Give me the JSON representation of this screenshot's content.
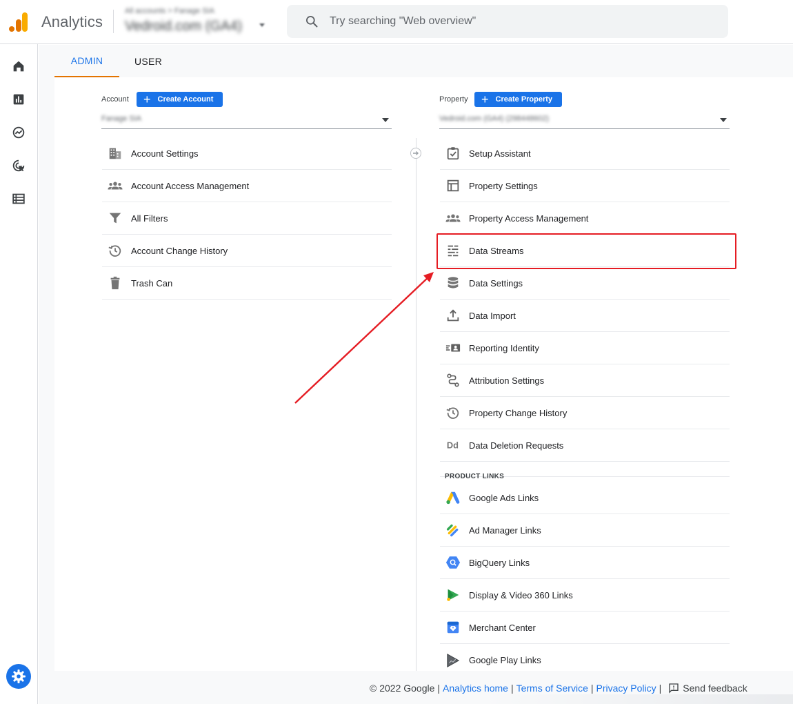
{
  "header": {
    "app_title": "Analytics",
    "account_path": "All accounts > Fanage SIA",
    "account_name": "Vedroid.com (GA4)",
    "search_placeholder": "Try searching \"Web overview\""
  },
  "rail": {
    "items": [
      {
        "name": "home",
        "icon": "home-icon"
      },
      {
        "name": "reports",
        "icon": "bar-chart-icon"
      },
      {
        "name": "explore",
        "icon": "explore-icon"
      },
      {
        "name": "advertising",
        "icon": "cursor-target-icon"
      },
      {
        "name": "configure",
        "icon": "list-icon"
      }
    ],
    "admin_icon": "gear-icon"
  },
  "tabs": [
    {
      "label": "ADMIN",
      "active": true
    },
    {
      "label": "USER",
      "active": false
    }
  ],
  "account_column": {
    "label": "Account",
    "create_label": "Create Account",
    "selected": "Fanage SIA",
    "items": [
      {
        "label": "Account Settings",
        "icon": "building-icon"
      },
      {
        "label": "Account Access Management",
        "icon": "people-icon"
      },
      {
        "label": "All Filters",
        "icon": "filter-icon"
      },
      {
        "label": "Account Change History",
        "icon": "history-icon"
      },
      {
        "label": "Trash Can",
        "icon": "trash-icon"
      }
    ]
  },
  "property_column": {
    "label": "Property",
    "create_label": "Create Property",
    "selected": "Vedroid.com (GA4) (298448602)",
    "items": [
      {
        "label": "Setup Assistant",
        "icon": "checkbox-icon"
      },
      {
        "label": "Property Settings",
        "icon": "layout-icon"
      },
      {
        "label": "Property Access Management",
        "icon": "people-icon"
      },
      {
        "label": "Data Streams",
        "icon": "streams-icon"
      },
      {
        "label": "Data Settings",
        "icon": "database-icon"
      },
      {
        "label": "Data Import",
        "icon": "upload-icon"
      },
      {
        "label": "Reporting Identity",
        "icon": "identity-icon"
      },
      {
        "label": "Attribution Settings",
        "icon": "attribution-icon"
      },
      {
        "label": "Property Change History",
        "icon": "history-icon"
      },
      {
        "label": "Data Deletion Requests",
        "icon": "dd-icon"
      }
    ],
    "product_links_heading": "PRODUCT LINKS",
    "product_links": [
      {
        "label": "Google Ads Links",
        "icon": "google-ads-icon"
      },
      {
        "label": "Ad Manager Links",
        "icon": "ad-manager-icon"
      },
      {
        "label": "BigQuery Links",
        "icon": "bigquery-icon"
      },
      {
        "label": "Display & Video 360 Links",
        "icon": "dv360-icon"
      },
      {
        "label": "Merchant Center",
        "icon": "merchant-center-icon"
      },
      {
        "label": "Google Play Links",
        "icon": "google-play-icon"
      }
    ]
  },
  "annotation": {
    "highlighted_item": "Data Streams",
    "color": "#e51c23"
  },
  "footer": {
    "copyright": "© 2022 Google",
    "links": [
      "Analytics home",
      "Terms of Service",
      "Privacy Policy"
    ],
    "feedback_label": "Send feedback"
  },
  "colors": {
    "accent": "#1a73e8",
    "tab_indicator": "#e37400",
    "annotation_red": "#e51c23"
  }
}
